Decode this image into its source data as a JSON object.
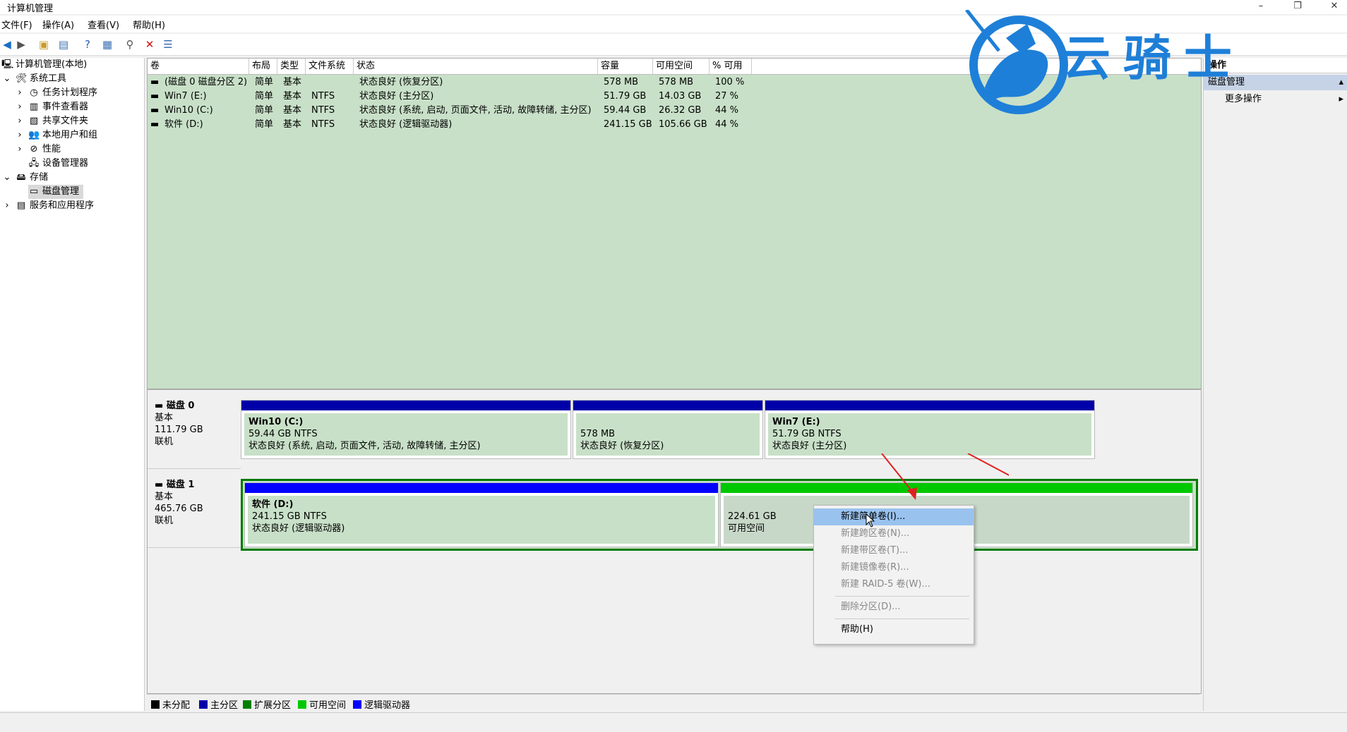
{
  "window": {
    "title": "计算机管理",
    "minimize": "–",
    "restore": "❐",
    "close": "✕"
  },
  "menu": [
    "文件(F)",
    "操作(A)",
    "查看(V)",
    "帮助(H)"
  ],
  "tree": {
    "root": "计算机管理(本地)",
    "system_tools": "系统工具",
    "task_scheduler": "任务计划程序",
    "event_viewer": "事件查看器",
    "shared_folders": "共享文件夹",
    "local_users": "本地用户和组",
    "performance": "性能",
    "device_manager": "设备管理器",
    "storage": "存储",
    "disk_management": "磁盘管理",
    "services_apps": "服务和应用程序"
  },
  "grid": {
    "headers": [
      "卷",
      "布局",
      "类型",
      "文件系统",
      "状态",
      "容量",
      "可用空间",
      "% 可用"
    ],
    "rows": [
      [
        "(磁盘 0 磁盘分区 2)",
        "简单",
        "基本",
        "",
        "状态良好 (恢复分区)",
        "578 MB",
        "578 MB",
        "100 %"
      ],
      [
        "Win7 (E:)",
        "简单",
        "基本",
        "NTFS",
        "状态良好 (主分区)",
        "51.79 GB",
        "14.03 GB",
        "27 %"
      ],
      [
        "Win10 (C:)",
        "简单",
        "基本",
        "NTFS",
        "状态良好 (系统, 启动, 页面文件, 活动, 故障转储, 主分区)",
        "59.44 GB",
        "26.32 GB",
        "44 %"
      ],
      [
        "软件 (D:)",
        "简单",
        "基本",
        "NTFS",
        "状态良好 (逻辑驱动器)",
        "241.15 GB",
        "105.66 GB",
        "44 %"
      ]
    ]
  },
  "disk0": {
    "name": "磁盘 0",
    "type": "基本",
    "size": "111.79 GB",
    "state": "联机",
    "partitions": [
      {
        "name": "Win10  (C:)",
        "size": "59.44 GB NTFS",
        "status": "状态良好 (系统, 启动, 页面文件, 活动, 故障转储, 主分区)"
      },
      {
        "name": "",
        "size": "578 MB",
        "status": "状态良好 (恢复分区)"
      },
      {
        "name": "Win7  (E:)",
        "size": "51.79 GB NTFS",
        "status": "状态良好 (主分区)"
      }
    ]
  },
  "disk1": {
    "name": "磁盘 1",
    "type": "基本",
    "size": "465.76 GB",
    "state": "联机",
    "partitions": [
      {
        "name": "软件  (D:)",
        "size": "241.15 GB NTFS",
        "status": "状态良好 (逻辑驱动器)"
      },
      {
        "name": "",
        "size": "224.61 GB",
        "status": "可用空间"
      }
    ]
  },
  "legend": [
    "未分配",
    "主分区",
    "扩展分区",
    "可用空间",
    "逻辑驱动器"
  ],
  "actions": {
    "header": "操作",
    "section": "磁盘管理",
    "more": "更多操作"
  },
  "context_menu": {
    "new_simple": "新建简单卷(I)...",
    "new_spanned": "新建跨区卷(N)...",
    "new_striped": "新建带区卷(T)...",
    "new_mirrored": "新建镜像卷(R)...",
    "new_raid5": "新建 RAID-5 卷(W)...",
    "delete": "删除分区(D)...",
    "help": "帮助(H)"
  },
  "watermark": {
    "text": "云骑士"
  },
  "colors": {
    "primary": "#0000a8",
    "free": "#00c800",
    "logical": "#0000ff",
    "extended": "#008000",
    "unallocated": "#000000",
    "grid_bg": "#c8e0c8",
    "highlight": "#99c2ef",
    "logo": "#1e7fd8"
  }
}
